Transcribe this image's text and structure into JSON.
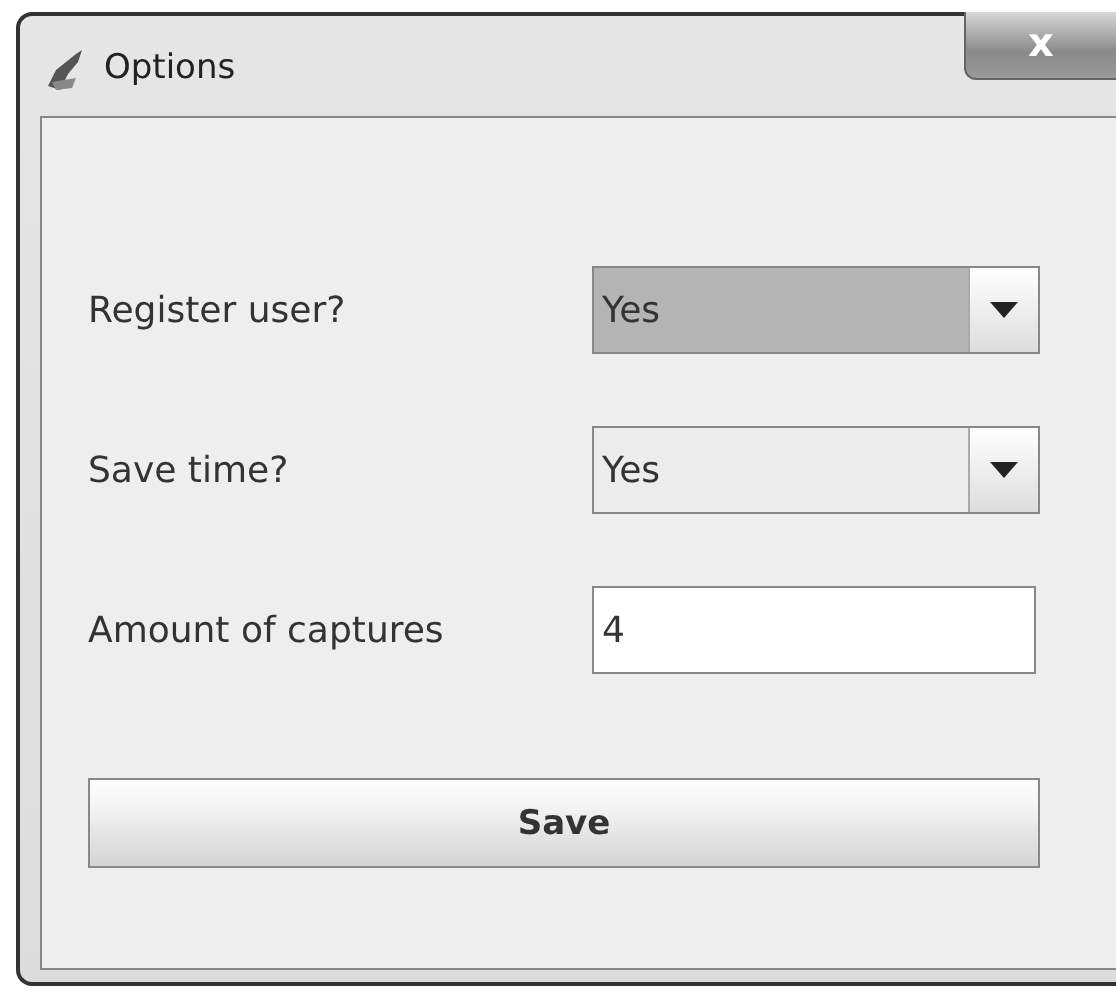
{
  "window": {
    "title": "Options",
    "close": "x"
  },
  "fields": [
    {
      "kind": "combo",
      "label": "Register user?",
      "value": "Yes",
      "focused": true
    },
    {
      "kind": "combo",
      "label": "Save time?",
      "value": "Yes",
      "focused": false
    },
    {
      "kind": "text",
      "label": "Amount of captures",
      "value": "4"
    }
  ],
  "button": "Save"
}
